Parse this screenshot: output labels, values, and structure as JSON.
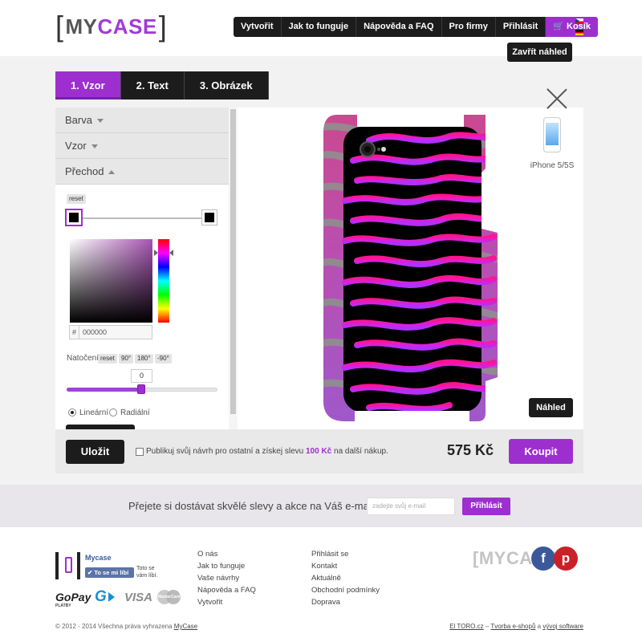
{
  "header": {
    "logo": {
      "left_bracket": "[",
      "my": "MY",
      "case": "CASE",
      "right_bracket": "]"
    },
    "nav": [
      {
        "label": "Vytvořit"
      },
      {
        "label": "Jak to funguje"
      },
      {
        "label": "Nápověda a FAQ"
      },
      {
        "label": "Pro firmy"
      },
      {
        "label": "Přihlásit"
      },
      {
        "label": "Košík"
      }
    ],
    "languages": [
      "cz-flag-icon",
      "de-flag-icon"
    ],
    "close_preview_label": "Zavřít náhled"
  },
  "tabs": [
    {
      "label": "1. Vzor",
      "active": true
    },
    {
      "label": "2. Text",
      "active": false
    },
    {
      "label": "3. Obrázek",
      "active": false
    }
  ],
  "sidebar": {
    "sections": [
      {
        "label": "Barva",
        "expanded": false
      },
      {
        "label": "Vzor",
        "expanded": false
      },
      {
        "label": "Přechod",
        "expanded": true
      }
    ],
    "gradient": {
      "reset_label": "reset",
      "color_hash": "#",
      "hex_value": "000000",
      "rotation_label": "Natočení",
      "rotation_buttons": [
        "reset",
        "90°",
        "180°",
        "-90°"
      ],
      "rotation_value": "0",
      "rotation_fraction": 0.5,
      "type_options": [
        "Lineární",
        "Radiální"
      ],
      "type_selected": "Lineární"
    }
  },
  "preview": {
    "model_label": "iPhone 5/5S",
    "preview_button": "Náhled",
    "pattern": "zebra-stripes",
    "colors": {
      "base": "#000000",
      "top": "#ff1493",
      "bottom": "#b030ff",
      "edge": "#8a8a8a"
    }
  },
  "bottom_bar": {
    "save_label": "Uložit",
    "publish_text_before": "Publikuj svůj návrh pro ostatní a získej slevu",
    "publish_discount": "100 Kč",
    "publish_text_after": "na další nákup.",
    "price": "575 Kč",
    "buy_label": "Koupit"
  },
  "newsletter": {
    "text": "Přejete si dostávat skvělé slevy a akce na Váš e-mail?",
    "placeholder": "zadejte svůj e-mail",
    "button": "Přihlásit"
  },
  "footer": {
    "facebook": {
      "name": "Mycase",
      "like": "✔ To se mi líbí",
      "like_text": "Toto se vám líbí."
    },
    "payments": {
      "gopay": "GoPay",
      "gopay_sub": "PLATBY",
      "g": "G",
      "visa": "VISA",
      "mastercard": "MasterCard"
    },
    "col1": [
      "O nás",
      "Jak to funguje",
      "Vaše návrhy",
      "Nápověda a FAQ",
      "Vytvořit"
    ],
    "col2": [
      "Přihlásit se",
      "Kontakt",
      "Aktuálně",
      "Obchodní podmínky",
      "Doprava"
    ],
    "brand_logo": "[MYCASE]",
    "social": [
      {
        "icon": "facebook-icon",
        "glyph": "f"
      },
      {
        "icon": "pinterest-icon",
        "glyph": "p"
      }
    ],
    "copyright_before": "© 2012 - 2014 Všechna práva vyhrazena",
    "copyright_link": "MyCase",
    "credit_link1": "El TORO.cz",
    "credit_sep": " – ",
    "credit_link2": "Tvorba e-shopů",
    "credit_and": " a ",
    "credit_link3": "vývoj software"
  },
  "colors": {
    "accent": "#9d2fcf",
    "dark": "#1c1c1c"
  }
}
